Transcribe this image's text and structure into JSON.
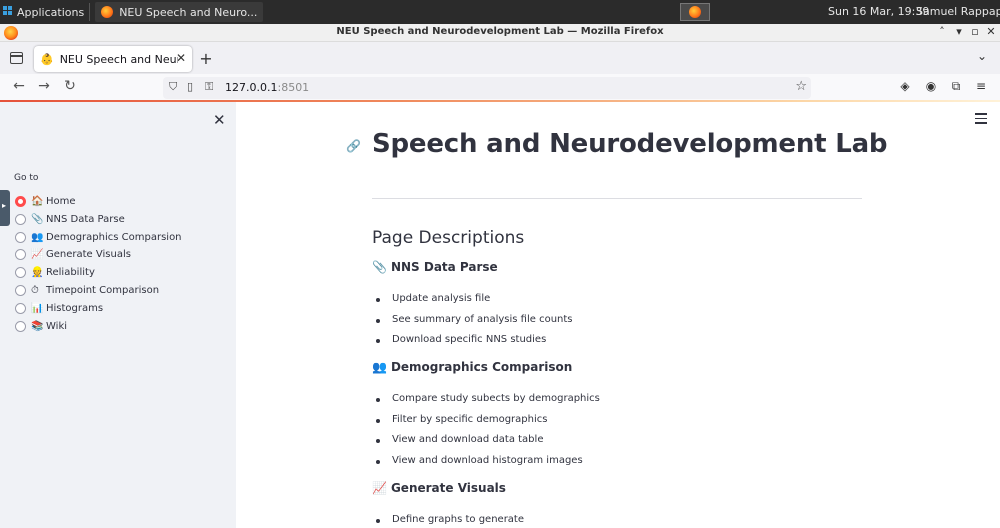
{
  "taskbar": {
    "apps_label": "Applications",
    "window_label": "NEU Speech and Neuro...",
    "clock": "Sun 16 Mar, 19:39",
    "user": "Samuel Rappaport"
  },
  "browser": {
    "window_title": "NEU Speech and Neurodevelopment Lab — Mozilla Firefox",
    "tab_title": "NEU Speech and Neurodevelopment Lab",
    "url_host": "127.0.0.1",
    "url_port": ":8501"
  },
  "sidebar": {
    "goto_label": "Go to",
    "items": [
      {
        "emoji": "🏠",
        "label": "Home",
        "selected": true
      },
      {
        "emoji": "📎",
        "label": "NNS Data Parse",
        "selected": false
      },
      {
        "emoji": "👥",
        "label": "Demographics Comparsion",
        "selected": false
      },
      {
        "emoji": "📈",
        "label": "Generate Visuals",
        "selected": false
      },
      {
        "emoji": "👷",
        "label": "Reliability",
        "selected": false
      },
      {
        "emoji": "⏱",
        "label": "Timepoint Comparison",
        "selected": false
      },
      {
        "emoji": "📊",
        "label": "Histograms",
        "selected": false
      },
      {
        "emoji": "📚",
        "label": "Wiki",
        "selected": false
      }
    ]
  },
  "main": {
    "title": "Speech and Neurodevelopment Lab",
    "section_heading": "Page Descriptions",
    "sections": [
      {
        "emoji": "📎",
        "heading": "NNS Data Parse",
        "bullets": [
          "Update analysis file",
          "See summary of analysis file counts",
          "Download specific NNS studies"
        ]
      },
      {
        "emoji": "👥",
        "heading": "Demographics Comparison",
        "bullets": [
          "Compare study subects by demographics",
          "Filter by specific demographics",
          "View and download data table",
          "View and download histogram images"
        ]
      },
      {
        "emoji": "📈",
        "heading": "Generate Visuals",
        "bullets": [
          "Define graphs to generate"
        ]
      }
    ]
  },
  "colors": {
    "accent": "#ff4b4b",
    "sidebar_bg": "#f0f2f6",
    "text": "#31333f"
  }
}
